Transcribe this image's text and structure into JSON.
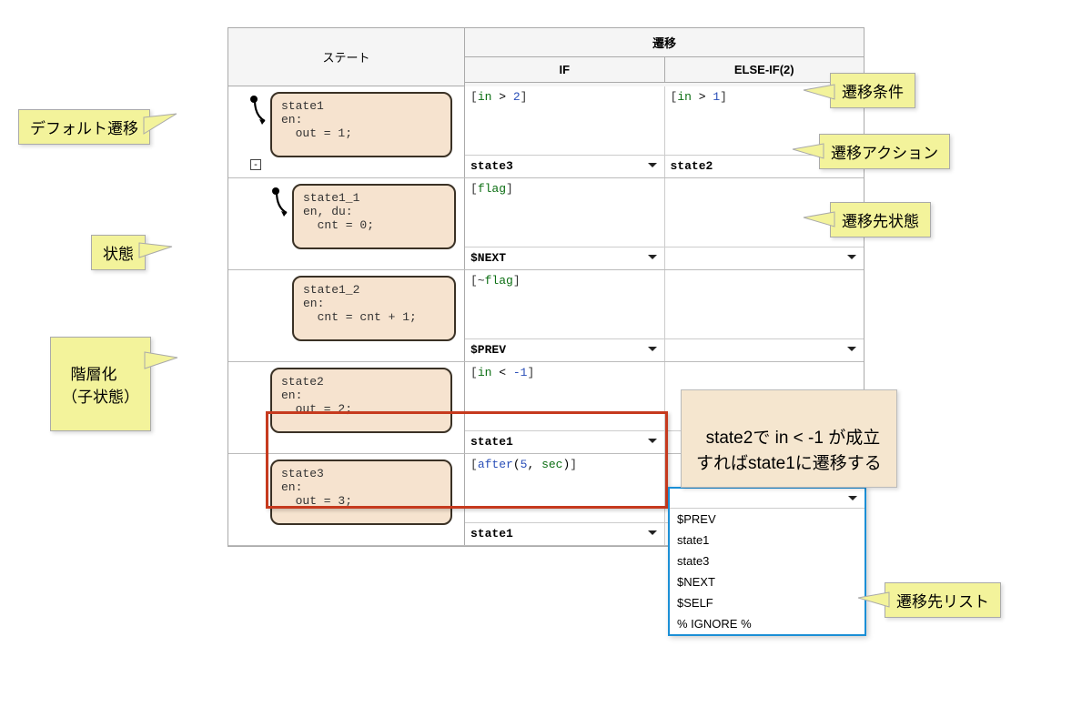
{
  "headers": {
    "state": "ステート",
    "transition": "遷移",
    "if": "IF",
    "elseif": "ELSE-IF(2)"
  },
  "rows": [
    {
      "state_name": "state1",
      "entry": "en:",
      "code": "  out = 1;",
      "has_default": true,
      "has_collapse": true,
      "if_cond": "[in > 2]",
      "elseif_cond": "[in > 1]",
      "if_dest": "state3",
      "elseif_dest": "state2"
    },
    {
      "state_name": "state1_1",
      "entry": "en, du:",
      "code": "  cnt = 0;",
      "has_default": true,
      "child": true,
      "if_cond": "[flag]",
      "elseif_cond": "",
      "if_dest": "$NEXT",
      "elseif_dest": ""
    },
    {
      "state_name": "state1_2",
      "entry": "en:",
      "code": "  cnt = cnt + 1;",
      "child": true,
      "if_cond": "[~flag]",
      "elseif_cond": "",
      "if_dest": "$PREV",
      "elseif_dest": ""
    },
    {
      "state_name": "state2",
      "entry": "en:",
      "code": "  out = 2;",
      "if_cond": "[in < -1]",
      "elseif_cond": "",
      "if_dest": "state1",
      "elseif_dest": ""
    },
    {
      "state_name": "state3",
      "entry": "en:",
      "code": "  out = 3;",
      "if_cond": "[after(5, sec)]",
      "elseif_cond": "",
      "if_dest": "state1",
      "elseif_dest": ""
    }
  ],
  "dropdown_options": [
    "$PREV",
    "state1",
    "state3",
    "$NEXT",
    "$SELF",
    "% IGNORE %"
  ],
  "callouts": {
    "default_transition": "デフォルト遷移",
    "state": "状態",
    "hierarchy": "階層化\n（子状態）",
    "condition": "遷移条件",
    "action": "遷移アクション",
    "dest_state": "遷移先状態",
    "dest_list": "遷移先リスト",
    "example": "state2で in < -1 が成立\nすればstate1に遷移する"
  }
}
